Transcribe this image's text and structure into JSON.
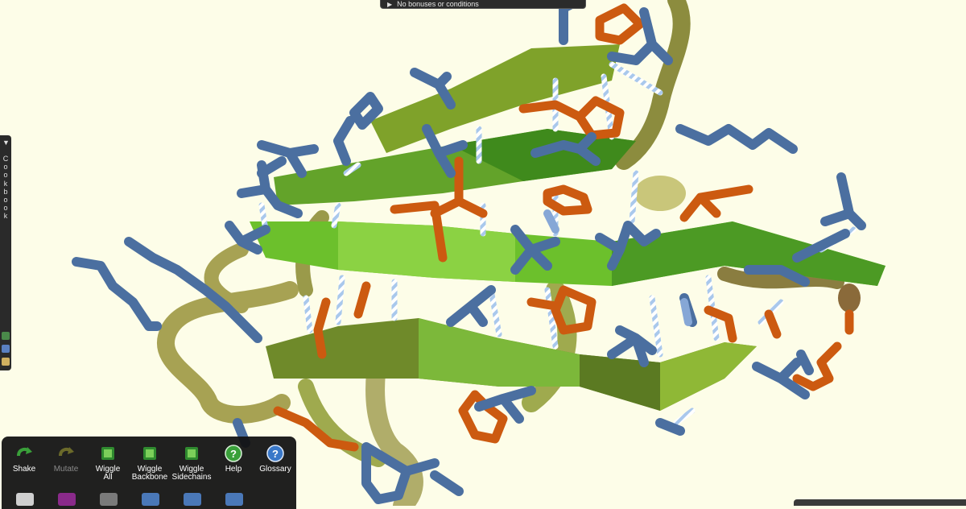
{
  "bonus_bar": {
    "label": "No bonuses or conditions"
  },
  "cookbook": {
    "label": "Cookbook"
  },
  "toolbar": {
    "tools": [
      {
        "label": "Shake",
        "icon": "shake-icon",
        "enabled": true
      },
      {
        "label": "Mutate",
        "icon": "mutate-icon",
        "enabled": false
      },
      {
        "label": "Wiggle\nAll",
        "icon": "wiggle-all-icon",
        "enabled": true
      },
      {
        "label": "Wiggle\nBackbone",
        "icon": "wiggle-backbone-icon",
        "enabled": true
      },
      {
        "label": "Wiggle\nSidechains",
        "icon": "wiggle-sidechains-icon",
        "enabled": true
      },
      {
        "label": "Help",
        "icon": "help-icon",
        "enabled": true
      },
      {
        "label": "Glossary",
        "icon": "glossary-icon",
        "enabled": true
      }
    ]
  },
  "colors": {
    "background": "#fdfde8",
    "sheet": "#6fbf2e",
    "sheet_dark": "#5a7d1f",
    "sheet_olive": "#8a9a3a",
    "sidechain_blue": "#4b6fa0",
    "sidechain_orange": "#cc5a10",
    "hbond": "#cfe0f5",
    "coil": "#a8a84e"
  }
}
